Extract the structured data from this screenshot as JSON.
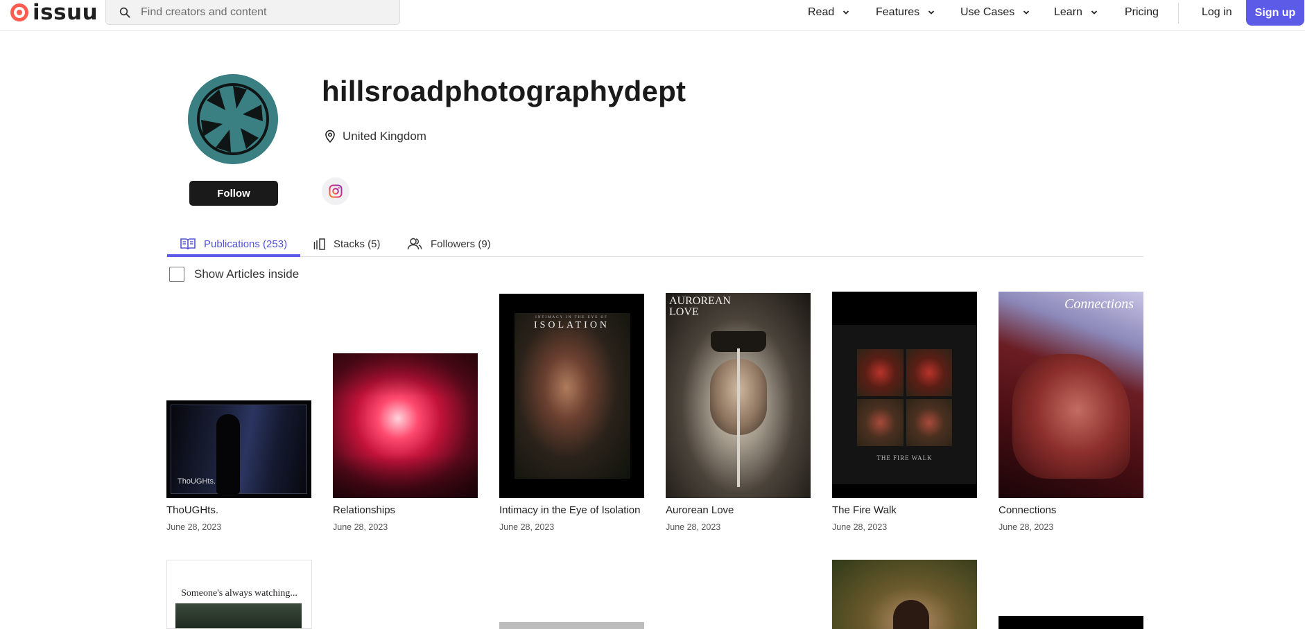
{
  "header": {
    "logo_text": "issuu",
    "search_placeholder": "Find creators and content",
    "nav": [
      {
        "label": "Read",
        "has_dropdown": true
      },
      {
        "label": "Features",
        "has_dropdown": true
      },
      {
        "label": "Use Cases",
        "has_dropdown": true
      },
      {
        "label": "Learn",
        "has_dropdown": true
      },
      {
        "label": "Pricing",
        "has_dropdown": false
      }
    ],
    "login_label": "Log in",
    "signup_label": "Sign up",
    "accent_color": "#5b5be8"
  },
  "profile": {
    "name": "hillsroadphotographydept",
    "location": "United Kingdom",
    "follow_label": "Follow",
    "social": [
      "instagram-icon"
    ]
  },
  "tabs": [
    {
      "label": "Publications (253)",
      "icon": "book-icon",
      "active": true
    },
    {
      "label": "Stacks (5)",
      "icon": "stacks-icon",
      "active": false
    },
    {
      "label": "Followers (9)",
      "icon": "users-icon",
      "active": false
    }
  ],
  "filter": {
    "show_articles_label": "Show Articles inside",
    "checked": false
  },
  "publications": [
    {
      "title": "ThoUGHts.",
      "date": "June 28, 2023",
      "cover_text": "ThoUGHts."
    },
    {
      "title": "Relationships",
      "date": "June 28, 2023"
    },
    {
      "title": "Intimacy in the Eye of Isolation",
      "date": "June 28, 2023",
      "cover_text": "ISOLATION",
      "cover_subtext": "INTIMACY IN THE EYE OF"
    },
    {
      "title": "Aurorean Love",
      "date": "June 28, 2023",
      "cover_text": "AUROREAN LOVE"
    },
    {
      "title": "The Fire Walk",
      "date": "June 28, 2023",
      "cover_text": "THE FIRE WALK"
    },
    {
      "title": "Connections",
      "date": "June 28, 2023",
      "cover_text": "Connections"
    }
  ],
  "second_row": [
    {
      "cover_text": "Someone's always watching..."
    }
  ]
}
